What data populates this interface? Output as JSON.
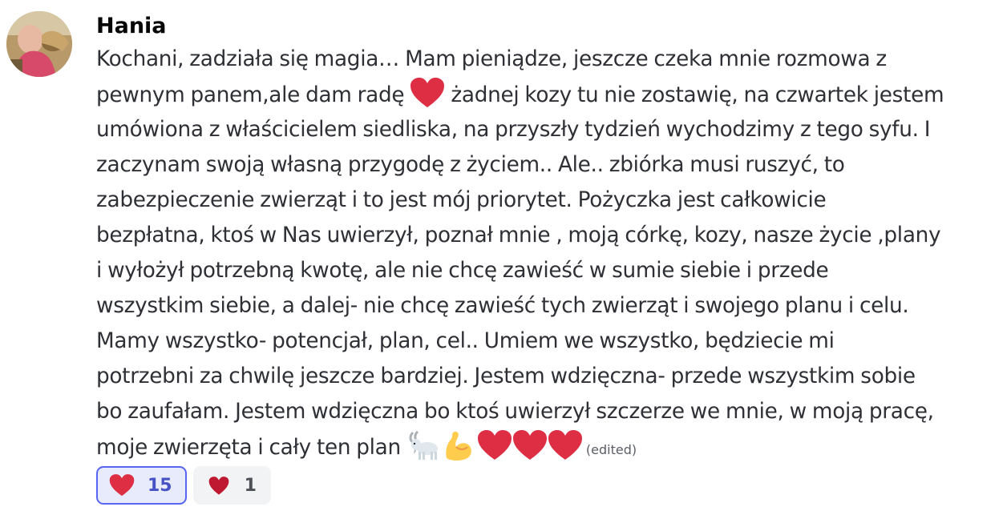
{
  "author": {
    "name": "Hania"
  },
  "message": {
    "lines": [
      "Kochani, zadziała się magia… Mam pieniądze, jeszcze czeka mnie rozmowa z",
      "pewnym panem,ale dam radę",
      "żadnej kozy tu nie zostawię, na czwartek jestem",
      "umówiona z właścicielem siedliska, na przyszły tydzień wychodzimy z tego syfu. I",
      "zaczynam swoją własną przygodę z życiem.. Ale.. zbiórka musi ruszyć, to",
      "zabezpieczenie zwierząt i to jest mój priorytet. Pożyczka jest całkowicie",
      "bezpłatna, ktoś w Nas uwierzył, poznał mnie , moją córkę, kozy, nasze życie ,plany",
      "i wyłożył potrzebną kwotę, ale nie chcę zawieść w sumie siebie i przede",
      "wszystkim siebie, a dalej- nie chcę zawieść tych zwierząt i swojego planu i celu.",
      "Mamy wszystko- potencjał, plan, cel.. Umiem we wszystko, będziecie mi",
      "potrzebni za chwilę jeszcze bardziej. Jestem wdzięczna- przede wszystkim sobie",
      "bo zaufałam. Jestem wdzięczna bo ktoś uwierzył szczerze we mnie, w moją pracę,",
      "moje zwierzęta i cały ten plan"
    ],
    "emojis": {
      "inline": "red-heart-icon",
      "ending": [
        "goat-icon",
        "flexed-biceps-icon",
        "red-heart-icon",
        "red-heart-icon",
        "red-heart-icon"
      ]
    },
    "edited_label": "(edited)"
  },
  "reactions": [
    {
      "emoji": "red-heart-icon",
      "count": "15",
      "active": true
    },
    {
      "emoji": "heavy-heart-icon",
      "count": "1",
      "active": false
    }
  ],
  "colors": {
    "accent": "#5865f2",
    "heart": "#dd2e44",
    "text": "#2e3035"
  }
}
